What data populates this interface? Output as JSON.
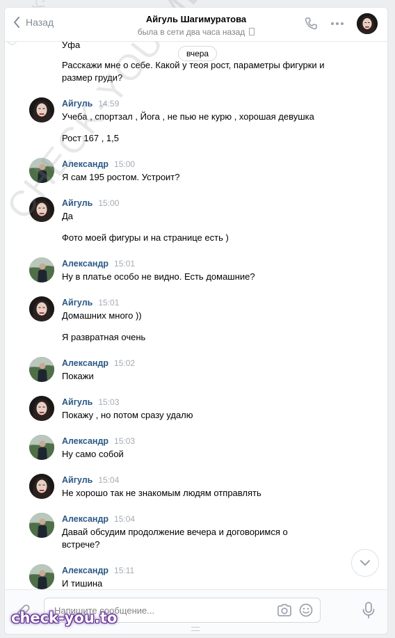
{
  "header": {
    "back_label": "Назад",
    "contact_name": "Айгуль Шагимуратова",
    "status": "была в сети два часа назад"
  },
  "chat": {
    "date_separator": "вчера",
    "messages": [
      {
        "text": "Уфа"
      },
      {
        "text": "Расскажи мне о себе. Какой у теоя рост, параметры фигурки и размер груди?"
      },
      {
        "author": "Айгуль",
        "time": "14:59",
        "lines": [
          "Учеба , спортзал , Йога , не пью не курю , хорошая девушка",
          "Рост 167 , 1,5"
        ]
      },
      {
        "author": "Александр",
        "time": "15:00",
        "lines": [
          "Я сам 195 ростом. Устроит?"
        ]
      },
      {
        "author": "Айгуль",
        "time": "15:00",
        "lines": [
          "Да",
          "Фото моей фигуры и на странице есть )"
        ]
      },
      {
        "author": "Александр",
        "time": "15:01",
        "lines": [
          "Ну в платье особо не видно. Есть домашние?"
        ]
      },
      {
        "author": "Айгуль",
        "time": "15:01",
        "lines": [
          "Домашних много ))",
          "Я развратная очень"
        ]
      },
      {
        "author": "Александр",
        "time": "15:02",
        "lines": [
          "Покажи"
        ]
      },
      {
        "author": "Айгуль",
        "time": "15:03",
        "lines": [
          "Покажу , но потом сразу удалю"
        ]
      },
      {
        "author": "Александр",
        "time": "15:03",
        "lines": [
          "Ну само собой"
        ]
      },
      {
        "author": "Айгуль",
        "time": "15:04",
        "lines": [
          "Не хорошо так не знакомым людям отправлять"
        ]
      },
      {
        "author": "Александр",
        "time": "15:04",
        "lines": [
          "Давай обсудим продолжение вечера и договоримся о встрече?"
        ]
      },
      {
        "author": "Александр",
        "time": "15:11",
        "lines": [
          "И тишина"
        ]
      }
    ]
  },
  "composer": {
    "placeholder": "Напишите сообщение..."
  },
  "watermark": {
    "diagonal_small": "CHECK-YOU.ME",
    "diagonal_big": "CHECK-YOU.ME",
    "logo": "check-you.to"
  }
}
